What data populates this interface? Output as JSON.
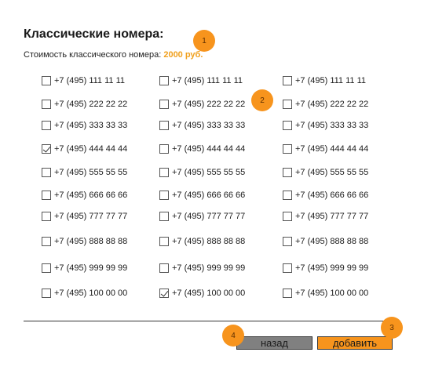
{
  "header": {
    "title": "Классические номера:",
    "price_label": "Стоимость классического номера:",
    "price_value": "2000 руб."
  },
  "numbers": {
    "rows": [
      [
        "+7 (495) 111 11 11",
        "+7 (495) 111 11 11",
        "+7 (495) 111 11 11"
      ],
      [
        "+7 (495) 222 22 22",
        "+7 (495) 222 22 22",
        "+7 (495) 222 22 22"
      ],
      [
        "+7 (495) 333 33 33",
        "+7 (495) 333 33 33",
        "+7 (495) 333 33 33"
      ],
      [
        "+7 (495) 444 44 44",
        "+7 (495) 444 44 44",
        "+7 (495) 444 44 44"
      ],
      [
        "+7 (495) 555 55 55",
        "+7 (495) 555 55 55",
        "+7 (495) 555 55 55"
      ],
      [
        "+7 (495) 666 66 66",
        "+7 (495) 666 66 66",
        "+7 (495) 666 66 66"
      ],
      [
        "+7 (495) 777 77 77",
        "+7 (495) 777 77 77",
        "+7 (495) 777 77 77"
      ],
      [
        "+7 (495) 888 88 88",
        "+7 (495) 888 88 88",
        "+7 (495) 888 88 88"
      ],
      [
        "+7 (495) 999 99 99",
        "+7 (495) 999 99 99",
        "+7 (495) 999 99 99"
      ],
      [
        "+7 (495) 100 00 00",
        "+7 (495) 100 00 00",
        "+7 (495) 100 00 00"
      ]
    ],
    "checked": [
      [
        3,
        0
      ],
      [
        9,
        1
      ]
    ]
  },
  "actions": {
    "back_label": "назад",
    "add_label": "добавить"
  },
  "markers": {
    "m1": "1",
    "m2": "2",
    "m3": "3",
    "m4": "4"
  },
  "colors": {
    "accent": "#f7941d",
    "price": "#f0a01e",
    "back_button": "#808080"
  }
}
